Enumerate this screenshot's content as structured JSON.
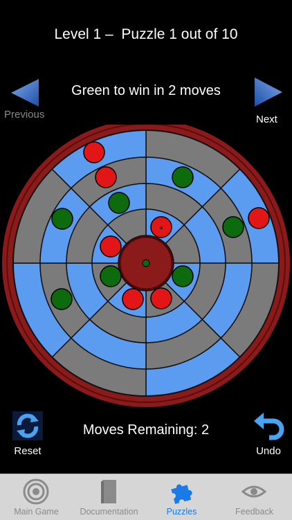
{
  "header": {
    "title": "Level 1 –  Puzzle 1 out of 10",
    "subtitle": "Green to win in 2 moves",
    "previous_label": "Previous",
    "next_label": "Next"
  },
  "board": {
    "colors": {
      "blue": "#5b9bf0",
      "gray": "#7b7b7b",
      "rim": "#8b1a1a",
      "red_piece": "#e21616",
      "green_piece": "#0d6b0d",
      "center": "#8b1a1a"
    },
    "rings": 4,
    "sectors": 8
  },
  "footer": {
    "moves_label": "Moves Remaining: 2",
    "reset_label": "Reset",
    "undo_label": "Undo"
  },
  "tabs": [
    {
      "label": "Main Game",
      "icon": "target-icon",
      "active": false
    },
    {
      "label": "Documentation",
      "icon": "book-icon",
      "active": false
    },
    {
      "label": "Puzzles",
      "icon": "puzzle-icon",
      "active": true
    },
    {
      "label": "Feedback",
      "icon": "eye-icon",
      "active": false
    }
  ]
}
